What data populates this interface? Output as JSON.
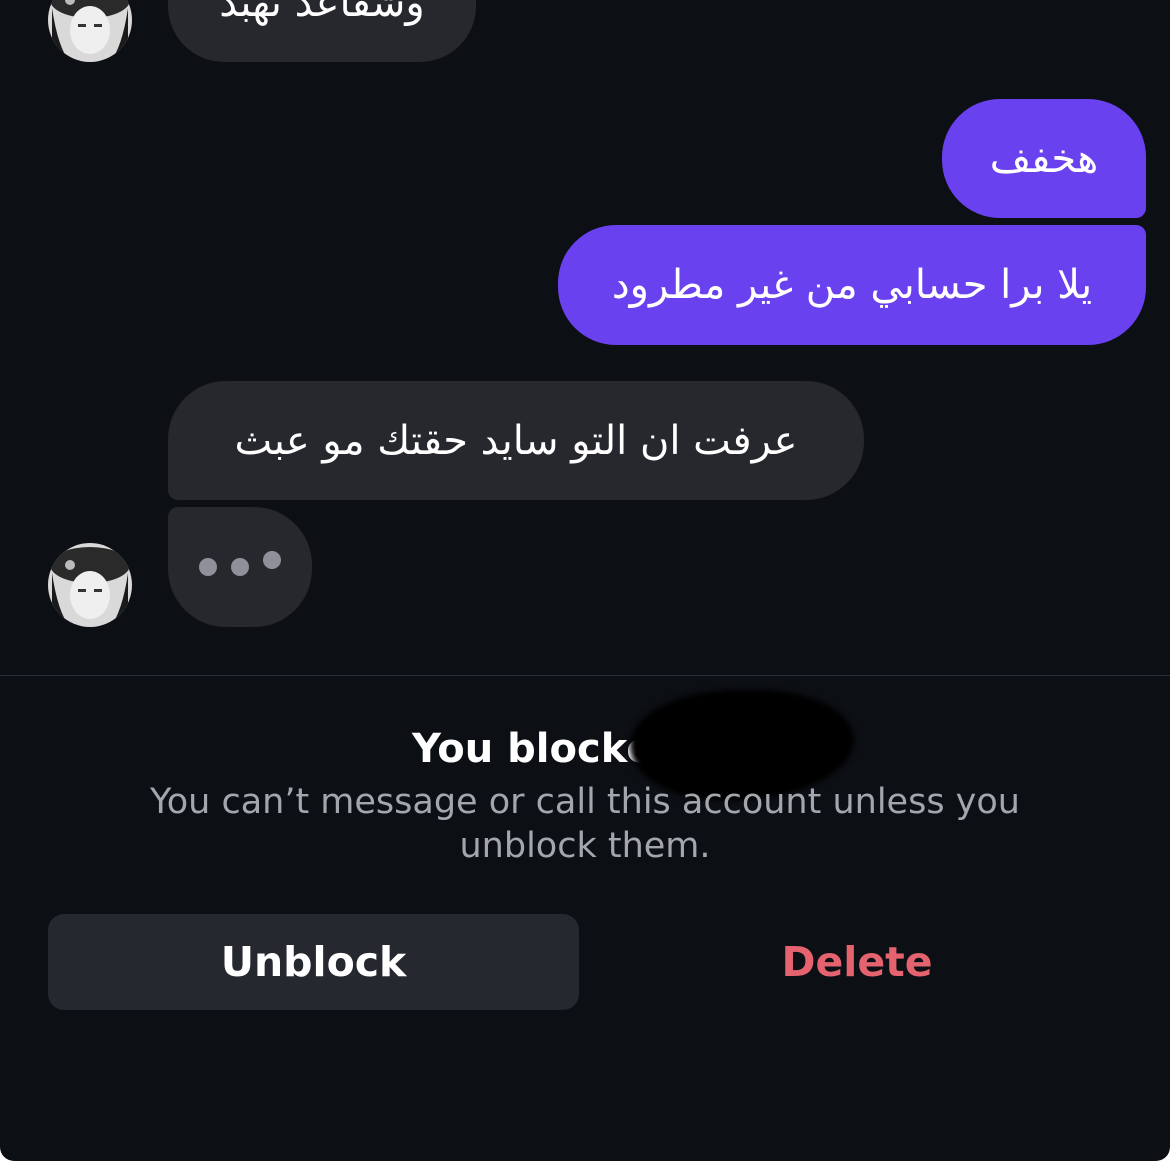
{
  "messages": [
    {
      "from": "contact",
      "text": "وشقاعد تهبد"
    },
    {
      "from": "me",
      "text": "هخفف"
    },
    {
      "from": "me",
      "text": "يلا برا حسابي من غير مطرود"
    },
    {
      "from": "contact",
      "text": "عرفت ان التو سايد حقتك مو عبث"
    },
    {
      "from": "contact",
      "typing": true
    }
  ],
  "block_notice": {
    "title": "You blocke",
    "description": "You can’t message or call this account unless you unblock them."
  },
  "actions": {
    "unblock_label": "Unblock",
    "delete_label": "Delete"
  },
  "colors": {
    "background": "#0c0f14",
    "incoming_bubble": "#26282e",
    "outgoing_bubble": "#6a41ee",
    "delete_text": "#e4636f"
  }
}
